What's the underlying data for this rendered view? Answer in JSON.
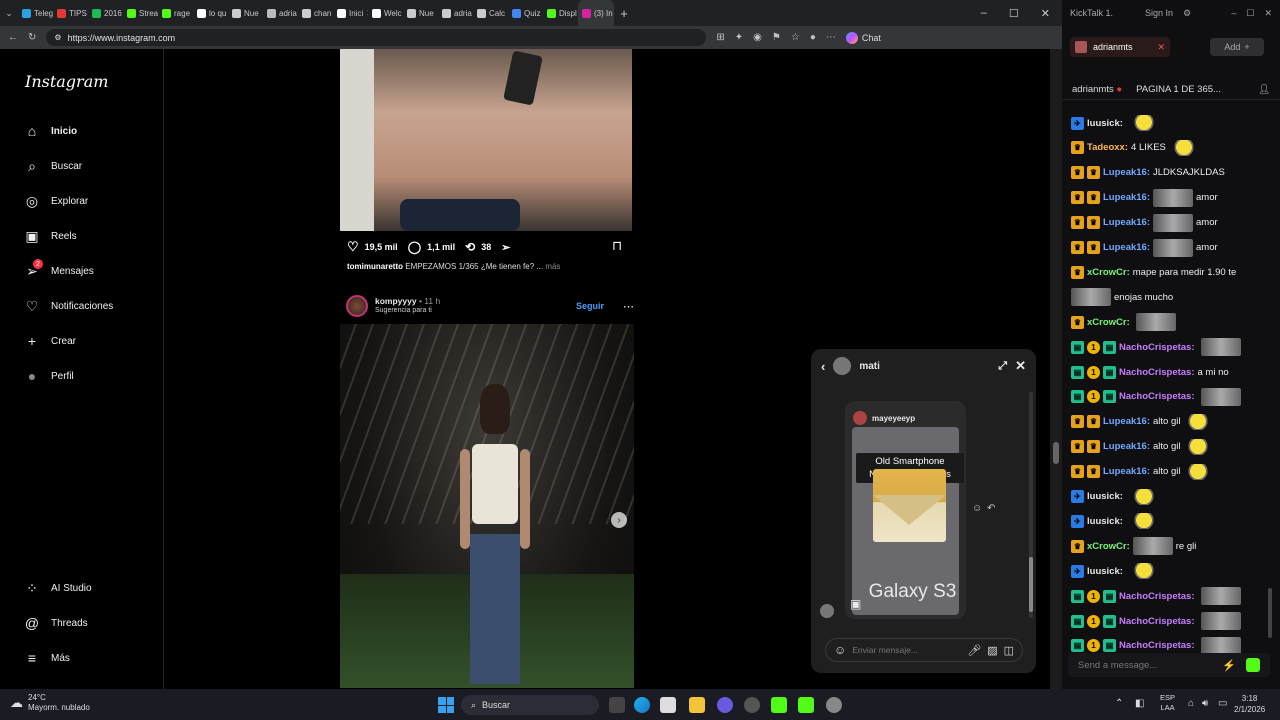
{
  "browser": {
    "tabs": [
      "Teleg",
      "TIPS",
      "2016",
      "Strea",
      "rage",
      "lo qu",
      "Nue",
      "adria",
      "chan",
      "Inici",
      "Welc",
      "Nue",
      "adria",
      "Calc",
      "Quiz",
      "Displ",
      "(3) In"
    ],
    "tab_colors": [
      "#2aa3e0",
      "#e53935",
      "#1db954",
      "#53fc18",
      "#53fc18",
      "#ffffff",
      "#cccccc",
      "#bbbbbb",
      "#cccccc",
      "#ffffff",
      "#ffffff",
      "#cccccc",
      "#cccccc",
      "#cccccc",
      "#4285f4",
      "#53fc18",
      "#d6249f"
    ],
    "url": "https://www.instagram.com",
    "copilot_label": "Chat"
  },
  "instagram": {
    "logo": "Instagram",
    "nav": [
      {
        "label": "Inicio",
        "icon": "home-icon"
      },
      {
        "label": "Buscar",
        "icon": "search-icon"
      },
      {
        "label": "Explorar",
        "icon": "compass-icon"
      },
      {
        "label": "Reels",
        "icon": "reels-icon"
      },
      {
        "label": "Mensajes",
        "icon": "messages-icon",
        "badge": "2"
      },
      {
        "label": "Notificaciones",
        "icon": "heart-icon"
      },
      {
        "label": "Crear",
        "icon": "plus-icon"
      },
      {
        "label": "Perfil",
        "icon": "avatar"
      }
    ],
    "nav_bottom": [
      {
        "label": "AI Studio",
        "icon": "ai-studio-icon"
      },
      {
        "label": "Threads",
        "icon": "threads-icon"
      },
      {
        "label": "Más",
        "icon": "menu-icon"
      }
    ],
    "post1": {
      "likes": "19,5 mil",
      "comments": "1,1 mil",
      "reposts": "38",
      "caption_user": "tomimunaretto",
      "caption_text": "EMPEZAMOS 1/365 ¿Me tienen fe? ...",
      "caption_more": "más"
    },
    "post2": {
      "user": "kompyyyy",
      "time": "• 11 h",
      "suggestion": "Sugerencia para ti",
      "follow": "Seguir"
    }
  },
  "dm": {
    "contact": "mati",
    "shared_user": "mayeyeeyp",
    "notif_title": "Old Smartphone Notification Sounds",
    "galaxy_text": "Galaxy S3",
    "placeholder": "Enviar mensaje..."
  },
  "kicktalk": {
    "app": "KickTalk 1.",
    "sign_in": "Sign In",
    "tab_name": "adrianmts",
    "add": "Add",
    "channel": "adrianmts",
    "channel_title": "PAGINA 1 DE 365...",
    "chat": [
      {
        "badges": [
          "blue"
        ],
        "user": "luusick:",
        "color": "#e8e8e8",
        "text": "",
        "media": "emote"
      },
      {
        "badges": [
          "gold"
        ],
        "user": "Tadeoxx:",
        "color": "#ffb84d",
        "text": "4 LIKES",
        "media": "emote"
      },
      {
        "badges": [
          "gold",
          "gold"
        ],
        "user": "Lupeak16:",
        "color": "#e8e8e8",
        "text": "JLDKSAJKLDAS",
        "media": ""
      },
      {
        "badges": [
          "gold",
          "gold"
        ],
        "user": "Lupeak16:",
        "color": "#e8e8e8",
        "text": "amor",
        "media": "pic"
      },
      {
        "badges": [
          "gold",
          "gold"
        ],
        "user": "Lupeak16:",
        "color": "#e8e8e8",
        "text": "amor",
        "media": "pic"
      },
      {
        "badges": [
          "gold",
          "gold"
        ],
        "user": "Lupeak16:",
        "color": "#e8e8e8",
        "text": "amor",
        "media": "pic"
      },
      {
        "badges": [
          "gold"
        ],
        "user": "xCrowCr:",
        "color": "#7cf27c",
        "text": "mape para medir 1.90 te",
        "media": ""
      },
      {
        "badges": [],
        "user": "",
        "color": "#e8e8e8",
        "text": "enojas mucho",
        "media": "pic"
      },
      {
        "badges": [
          "gold"
        ],
        "user": "xCrowCr:",
        "color": "#7cf27c",
        "text": "",
        "media": "pic"
      },
      {
        "badges": [
          "gift",
          "sub",
          "gift"
        ],
        "user": "NachoCrispetas:",
        "color": "#c77dff",
        "text": "",
        "media": "pic"
      },
      {
        "badges": [
          "gift",
          "sub",
          "gift"
        ],
        "user": "NachoCrispetas:",
        "color": "#c77dff",
        "text": "a mi no",
        "media": ""
      },
      {
        "badges": [
          "gift",
          "sub",
          "gift"
        ],
        "user": "NachoCrispetas:",
        "color": "#c77dff",
        "text": "",
        "media": "pic"
      },
      {
        "badges": [
          "gold",
          "gold"
        ],
        "user": "Lupeak16:",
        "color": "#e8e8e8",
        "text": "alto gil",
        "media": "emote"
      },
      {
        "badges": [
          "gold",
          "gold"
        ],
        "user": "Lupeak16:",
        "color": "#e8e8e8",
        "text": "alto gil",
        "media": "emote"
      },
      {
        "badges": [
          "gold",
          "gold"
        ],
        "user": "Lupeak16:",
        "color": "#e8e8e8",
        "text": "alto gil",
        "media": "emote"
      },
      {
        "badges": [
          "blue"
        ],
        "user": "luusick:",
        "color": "#e8e8e8",
        "text": "",
        "media": "emote"
      },
      {
        "badges": [
          "blue"
        ],
        "user": "luusick:",
        "color": "#e8e8e8",
        "text": "",
        "media": "emote"
      },
      {
        "badges": [
          "gold"
        ],
        "user": "xCrowCr:",
        "color": "#7cf27c",
        "text": "re gli",
        "media": "pic"
      },
      {
        "badges": [
          "blue"
        ],
        "user": "luusick:",
        "color": "#e8e8e8",
        "text": "",
        "media": "emote"
      },
      {
        "badges": [
          "gift",
          "sub",
          "gift"
        ],
        "user": "NachoCrispetas:",
        "color": "#c77dff",
        "text": "",
        "media": "pic"
      },
      {
        "badges": [
          "gift",
          "sub",
          "gift"
        ],
        "user": "NachoCrispetas:",
        "color": "#c77dff",
        "text": "",
        "media": "pic"
      },
      {
        "badges": [
          "gift",
          "sub",
          "gift"
        ],
        "user": "NachoCrispetas:",
        "color": "#c77dff",
        "text": "",
        "media": "pic"
      }
    ],
    "send_placeholder": "Send a message..."
  },
  "taskbar": {
    "temp": "24°C",
    "weather": "Mayorm. nublado",
    "search": "Buscar",
    "lang1": "ESP",
    "lang2": "LAA",
    "time": "3:18",
    "date": "2/1/2026"
  }
}
